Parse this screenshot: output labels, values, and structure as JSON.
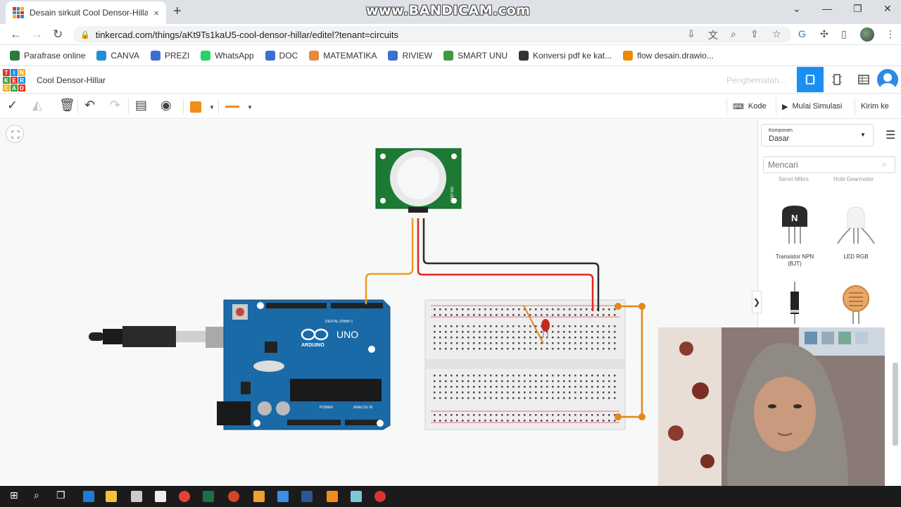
{
  "browser": {
    "tab_title": "Desain sirkuit Cool Densor-Hillar",
    "tab_close": "×",
    "new_tab": "+",
    "watermark": "www.BANDICAM.com",
    "url": "tinkercad.com/things/aKt9Ts1kaU5-cool-densor-hillar/editel?tenant=circuits",
    "bookmarks": [
      {
        "label": "Parafrase online",
        "icon": "parafrase-icon",
        "color": "#2b7a3d"
      },
      {
        "label": "CANVA",
        "icon": "canva-icon",
        "color": "#1f8fd6"
      },
      {
        "label": "PREZI",
        "icon": "prezi-icon",
        "color": "#3b6fd1"
      },
      {
        "label": "WhatsApp",
        "icon": "whatsapp-icon",
        "color": "#25d366"
      },
      {
        "label": "DOC",
        "icon": "docs-icon",
        "color": "#3b6fd1"
      },
      {
        "label": "MATEMATIKA",
        "icon": "matematika-icon",
        "color": "#e5893a"
      },
      {
        "label": "RIVIEW",
        "icon": "riview-icon",
        "color": "#3b6fd1"
      },
      {
        "label": "SMART UNU",
        "icon": "smartunu-icon",
        "color": "#3d9a3d"
      },
      {
        "label": "Konversi pdf ke kat...",
        "icon": "konversi-icon",
        "color": "#333333"
      },
      {
        "label": "flow desain.drawio...",
        "icon": "drawio-icon",
        "color": "#f08705"
      }
    ]
  },
  "app": {
    "logo_letters": [
      "TIN",
      "KER",
      "CAD"
    ],
    "project_title": "Cool Densor-Hillar",
    "saving_status": "Penghematan...",
    "accent": "#1a8ff2",
    "code_button": "Kode",
    "start_sim_button": "Mulai Simulasi",
    "send_button": "Kirim ke",
    "components_label": "Komponen",
    "components_value": "Dasar",
    "search_placeholder": "Mencari",
    "cut_labels": [
      "Servo Mikro",
      "Hobi Gearmotor"
    ],
    "components": [
      {
        "label": "Transistor NPN (BJT)",
        "icon": "transistor-icon",
        "glyph": "N"
      },
      {
        "label": "LED RGB",
        "icon": "led-rgb-icon"
      },
      {
        "label": "",
        "icon": "diode-icon"
      },
      {
        "label": "",
        "icon": "photoresistor-icon"
      }
    ],
    "panel_toggle": "❯",
    "circuit": {
      "arduino_label": "UNO",
      "arduino_brand": "ARDUINO",
      "digital_label": "DIGITAL (PWM~)",
      "power_label": "POWER",
      "analog_label": "ANALOG IN",
      "pir_id": "555-28027",
      "wire_colors": {
        "signal": "#f09a1a",
        "power": "#e0281b",
        "ground": "#2b2b2b",
        "rail": "#e08a1a"
      }
    }
  }
}
